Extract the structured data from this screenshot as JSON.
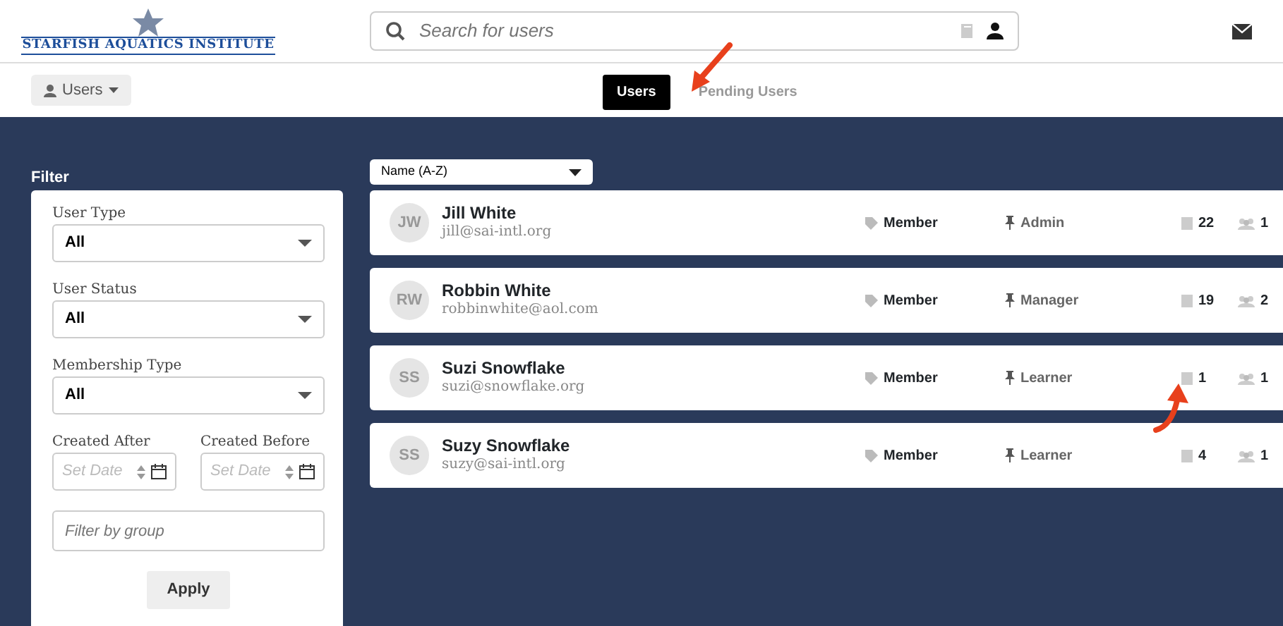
{
  "logo": {
    "text": "STARFISH AQUATICS INSTITUTE"
  },
  "search": {
    "placeholder": "Search for users"
  },
  "user_menu": {
    "label": "Users"
  },
  "tabs": [
    {
      "label": "Users",
      "selected": true
    },
    {
      "label": "Pending Users",
      "selected": false
    }
  ],
  "filter": {
    "title": "Filter",
    "selects": [
      {
        "label": "User Type",
        "value": "All"
      },
      {
        "label": "User Status",
        "value": "All"
      },
      {
        "label": "Membership Type",
        "value": "All"
      }
    ],
    "dates": [
      {
        "label": "Created After",
        "placeholder": "Set Date"
      },
      {
        "label": "Created Before",
        "placeholder": "Set Date"
      }
    ],
    "group": {
      "placeholder": "Filter by group"
    },
    "apply": "Apply"
  },
  "sort": {
    "value": "Name (A-Z)"
  },
  "users": [
    {
      "initials": "JW",
      "name": "Jill White",
      "email": "jill@sai-intl.org",
      "membership": "Member",
      "role": "Admin",
      "courses": "22",
      "groups": "1"
    },
    {
      "initials": "RW",
      "name": "Robbin White",
      "email": "robbinwhite@aol.com",
      "membership": "Member",
      "role": "Manager",
      "courses": "19",
      "groups": "2"
    },
    {
      "initials": "SS",
      "name": "Suzi Snowflake",
      "email": "suzi@snowflake.org",
      "membership": "Member",
      "role": "Learner",
      "courses": "1",
      "groups": "1"
    },
    {
      "initials": "SS",
      "name": "Suzy Snowflake",
      "email": "suzy@sai-intl.org",
      "membership": "Member",
      "role": "Learner",
      "courses": "4",
      "groups": "1"
    }
  ]
}
